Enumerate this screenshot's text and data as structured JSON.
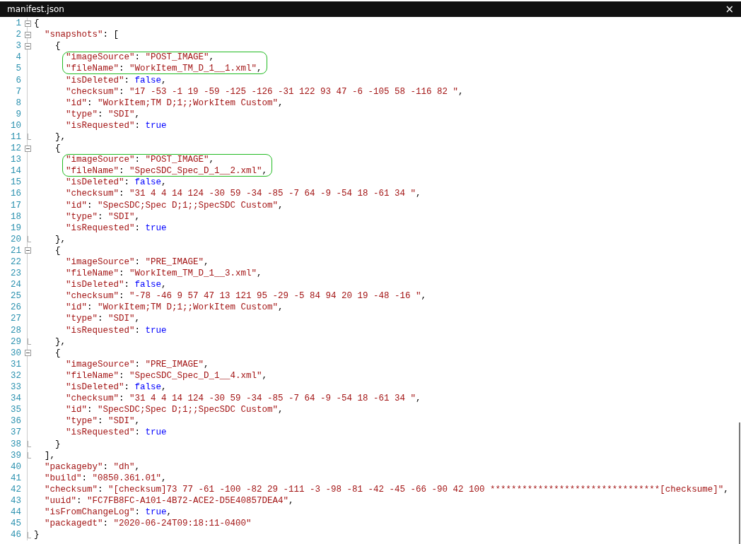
{
  "window": {
    "title": "manifest.json",
    "close": "×"
  },
  "lines": [
    {
      "number": "1",
      "expanded": true,
      "segments": [
        {
          "kind": "punct",
          "text": "{"
        }
      ],
      "children": [
        {
          "number": "2",
          "expanded": true,
          "segments": [
            {
              "kind": "string",
              "text": "\"snapshots\""
            },
            {
              "kind": "punct",
              "text": ": ["
            }
          ],
          "children": [
            {
              "number": "3",
              "expanded": true,
              "segments": [
                {
                  "kind": "punct",
                  "text": "{"
                }
              ],
              "children": [
                {
                  "number": "4",
                  "boxed": true,
                  "segments": [
                    {
                      "kind": "string",
                      "text": "\"imageSource\""
                    },
                    {
                      "kind": "punct",
                      "text": ": "
                    },
                    {
                      "kind": "string",
                      "text": "\"POST_IMAGE\""
                    },
                    {
                      "kind": "punct",
                      "text": ","
                    }
                  ]
                },
                {
                  "number": "5",
                  "boxed": true,
                  "segments": [
                    {
                      "kind": "string",
                      "text": "\"fileName\""
                    },
                    {
                      "kind": "punct",
                      "text": ": "
                    },
                    {
                      "kind": "string",
                      "text": "\"WorkItem_TM_D_1__1.xml\""
                    },
                    {
                      "kind": "punct",
                      "text": ","
                    }
                  ]
                },
                {
                  "number": "6",
                  "boxed": false,
                  "segments": [
                    {
                      "kind": "string",
                      "text": "\"isDeleted\""
                    },
                    {
                      "kind": "punct",
                      "text": ": "
                    },
                    {
                      "kind": "keyword",
                      "text": "false"
                    },
                    {
                      "kind": "punct",
                      "text": ","
                    }
                  ]
                },
                {
                  "number": "7",
                  "boxed": false,
                  "segments": [
                    {
                      "kind": "string",
                      "text": "\"checksum\""
                    },
                    {
                      "kind": "punct",
                      "text": ": "
                    },
                    {
                      "kind": "string",
                      "text": "\"17 -53 -1 19 -59 -125 -126 -31 122 93 47 -6 -105 58 -116 82 \""
                    },
                    {
                      "kind": "punct",
                      "text": ","
                    }
                  ]
                },
                {
                  "number": "8",
                  "boxed": false,
                  "segments": [
                    {
                      "kind": "string",
                      "text": "\"id\""
                    },
                    {
                      "kind": "punct",
                      "text": ": "
                    },
                    {
                      "kind": "string",
                      "text": "\"WorkItem;TM D;1;;WorkItem Custom\""
                    },
                    {
                      "kind": "punct",
                      "text": ","
                    }
                  ]
                },
                {
                  "number": "9",
                  "boxed": false,
                  "segments": [
                    {
                      "kind": "string",
                      "text": "\"type\""
                    },
                    {
                      "kind": "punct",
                      "text": ": "
                    },
                    {
                      "kind": "string",
                      "text": "\"SDI\""
                    },
                    {
                      "kind": "punct",
                      "text": ","
                    }
                  ]
                },
                {
                  "number": "10",
                  "boxed": false,
                  "segments": [
                    {
                      "kind": "string",
                      "text": "\"isRequested\""
                    },
                    {
                      "kind": "punct",
                      "text": ": "
                    },
                    {
                      "kind": "keyword",
                      "text": "true"
                    }
                  ]
                }
              ]
            },
            {
              "number": "11",
              "segments": [
                {
                  "kind": "punct",
                  "text": "},"
                }
              ]
            },
            {
              "number": "12",
              "expanded": true,
              "segments": [
                {
                  "kind": "punct",
                  "text": "{"
                }
              ],
              "children": [
                {
                  "number": "13",
                  "boxed": true,
                  "segments": [
                    {
                      "kind": "string",
                      "text": "\"imageSource\""
                    },
                    {
                      "kind": "punct",
                      "text": ": "
                    },
                    {
                      "kind": "string",
                      "text": "\"POST_IMAGE\""
                    },
                    {
                      "kind": "punct",
                      "text": ","
                    }
                  ]
                },
                {
                  "number": "14",
                  "boxed": true,
                  "segments": [
                    {
                      "kind": "string",
                      "text": "\"fileName\""
                    },
                    {
                      "kind": "punct",
                      "text": ": "
                    },
                    {
                      "kind": "string",
                      "text": "\"SpecSDC_Spec_D_1__2.xml\""
                    },
                    {
                      "kind": "punct",
                      "text": ","
                    }
                  ]
                },
                {
                  "number": "15",
                  "boxed": false,
                  "segments": [
                    {
                      "kind": "string",
                      "text": "\"isDeleted\""
                    },
                    {
                      "kind": "punct",
                      "text": ": "
                    },
                    {
                      "kind": "keyword",
                      "text": "false"
                    },
                    {
                      "kind": "punct",
                      "text": ","
                    }
                  ]
                },
                {
                  "number": "16",
                  "boxed": false,
                  "segments": [
                    {
                      "kind": "string",
                      "text": "\"checksum\""
                    },
                    {
                      "kind": "punct",
                      "text": ": "
                    },
                    {
                      "kind": "string",
                      "text": "\"31 4 4 14 124 -30 59 -34 -85 -7 64 -9 -54 18 -61 34 \""
                    },
                    {
                      "kind": "punct",
                      "text": ","
                    }
                  ]
                },
                {
                  "number": "17",
                  "boxed": false,
                  "segments": [
                    {
                      "kind": "string",
                      "text": "\"id\""
                    },
                    {
                      "kind": "punct",
                      "text": ": "
                    },
                    {
                      "kind": "string",
                      "text": "\"SpecSDC;Spec D;1;;SpecSDC Custom\""
                    },
                    {
                      "kind": "punct",
                      "text": ","
                    }
                  ]
                },
                {
                  "number": "18",
                  "boxed": false,
                  "segments": [
                    {
                      "kind": "string",
                      "text": "\"type\""
                    },
                    {
                      "kind": "punct",
                      "text": ": "
                    },
                    {
                      "kind": "string",
                      "text": "\"SDI\""
                    },
                    {
                      "kind": "punct",
                      "text": ","
                    }
                  ]
                },
                {
                  "number": "19",
                  "boxed": false,
                  "segments": [
                    {
                      "kind": "string",
                      "text": "\"isRequested\""
                    },
                    {
                      "kind": "punct",
                      "text": ": "
                    },
                    {
                      "kind": "keyword",
                      "text": "true"
                    }
                  ]
                }
              ]
            },
            {
              "number": "20",
              "segments": [
                {
                  "kind": "punct",
                  "text": "},"
                }
              ]
            },
            {
              "number": "21",
              "expanded": true,
              "segments": [
                {
                  "kind": "punct",
                  "text": "{"
                }
              ],
              "children": [
                {
                  "number": "22",
                  "boxed": false,
                  "segments": [
                    {
                      "kind": "string",
                      "text": "\"imageSource\""
                    },
                    {
                      "kind": "punct",
                      "text": ": "
                    },
                    {
                      "kind": "string",
                      "text": "\"PRE_IMAGE\""
                    },
                    {
                      "kind": "punct",
                      "text": ","
                    }
                  ]
                },
                {
                  "number": "23",
                  "boxed": false,
                  "segments": [
                    {
                      "kind": "string",
                      "text": "\"fileName\""
                    },
                    {
                      "kind": "punct",
                      "text": ": "
                    },
                    {
                      "kind": "string",
                      "text": "\"WorkItem_TM_D_1__3.xml\""
                    },
                    {
                      "kind": "punct",
                      "text": ","
                    }
                  ]
                },
                {
                  "number": "24",
                  "boxed": false,
                  "segments": [
                    {
                      "kind": "string",
                      "text": "\"isDeleted\""
                    },
                    {
                      "kind": "punct",
                      "text": ": "
                    },
                    {
                      "kind": "keyword",
                      "text": "false"
                    },
                    {
                      "kind": "punct",
                      "text": ","
                    }
                  ]
                },
                {
                  "number": "25",
                  "boxed": false,
                  "segments": [
                    {
                      "kind": "string",
                      "text": "\"checksum\""
                    },
                    {
                      "kind": "punct",
                      "text": ": "
                    },
                    {
                      "kind": "string",
                      "text": "\"-78 -46 9 57 47 13 121 95 -29 -5 84 94 20 19 -48 -16 \""
                    },
                    {
                      "kind": "punct",
                      "text": ","
                    }
                  ]
                },
                {
                  "number": "26",
                  "boxed": false,
                  "segments": [
                    {
                      "kind": "string",
                      "text": "\"id\""
                    },
                    {
                      "kind": "punct",
                      "text": ": "
                    },
                    {
                      "kind": "string",
                      "text": "\"WorkItem;TM D;1;;WorkItem Custom\""
                    },
                    {
                      "kind": "punct",
                      "text": ","
                    }
                  ]
                },
                {
                  "number": "27",
                  "boxed": false,
                  "segments": [
                    {
                      "kind": "string",
                      "text": "\"type\""
                    },
                    {
                      "kind": "punct",
                      "text": ": "
                    },
                    {
                      "kind": "string",
                      "text": "\"SDI\""
                    },
                    {
                      "kind": "punct",
                      "text": ","
                    }
                  ]
                },
                {
                  "number": "28",
                  "boxed": false,
                  "segments": [
                    {
                      "kind": "string",
                      "text": "\"isRequested\""
                    },
                    {
                      "kind": "punct",
                      "text": ": "
                    },
                    {
                      "kind": "keyword",
                      "text": "true"
                    }
                  ]
                }
              ]
            },
            {
              "number": "29",
              "segments": [
                {
                  "kind": "punct",
                  "text": "},"
                }
              ]
            },
            {
              "number": "30",
              "expanded": true,
              "segments": [
                {
                  "kind": "punct",
                  "text": "{"
                }
              ],
              "children": [
                {
                  "number": "31",
                  "boxed": false,
                  "segments": [
                    {
                      "kind": "string",
                      "text": "\"imageSource\""
                    },
                    {
                      "kind": "punct",
                      "text": ": "
                    },
                    {
                      "kind": "string",
                      "text": "\"PRE_IMAGE\""
                    },
                    {
                      "kind": "punct",
                      "text": ","
                    }
                  ]
                },
                {
                  "number": "32",
                  "boxed": false,
                  "segments": [
                    {
                      "kind": "string",
                      "text": "\"fileName\""
                    },
                    {
                      "kind": "punct",
                      "text": ": "
                    },
                    {
                      "kind": "string",
                      "text": "\"SpecSDC_Spec_D_1__4.xml\""
                    },
                    {
                      "kind": "punct",
                      "text": ","
                    }
                  ]
                },
                {
                  "number": "33",
                  "boxed": false,
                  "segments": [
                    {
                      "kind": "string",
                      "text": "\"isDeleted\""
                    },
                    {
                      "kind": "punct",
                      "text": ": "
                    },
                    {
                      "kind": "keyword",
                      "text": "false"
                    },
                    {
                      "kind": "punct",
                      "text": ","
                    }
                  ]
                },
                {
                  "number": "34",
                  "boxed": false,
                  "segments": [
                    {
                      "kind": "string",
                      "text": "\"checksum\""
                    },
                    {
                      "kind": "punct",
                      "text": ": "
                    },
                    {
                      "kind": "string",
                      "text": "\"31 4 4 14 124 -30 59 -34 -85 -7 64 -9 -54 18 -61 34 \""
                    },
                    {
                      "kind": "punct",
                      "text": ","
                    }
                  ]
                },
                {
                  "number": "35",
                  "boxed": false,
                  "segments": [
                    {
                      "kind": "string",
                      "text": "\"id\""
                    },
                    {
                      "kind": "punct",
                      "text": ": "
                    },
                    {
                      "kind": "string",
                      "text": "\"SpecSDC;Spec D;1;;SpecSDC Custom\""
                    },
                    {
                      "kind": "punct",
                      "text": ","
                    }
                  ]
                },
                {
                  "number": "36",
                  "boxed": false,
                  "segments": [
                    {
                      "kind": "string",
                      "text": "\"type\""
                    },
                    {
                      "kind": "punct",
                      "text": ": "
                    },
                    {
                      "kind": "string",
                      "text": "\"SDI\""
                    },
                    {
                      "kind": "punct",
                      "text": ","
                    }
                  ]
                },
                {
                  "number": "37",
                  "boxed": false,
                  "segments": [
                    {
                      "kind": "string",
                      "text": "\"isRequested\""
                    },
                    {
                      "kind": "punct",
                      "text": ": "
                    },
                    {
                      "kind": "keyword",
                      "text": "true"
                    }
                  ]
                }
              ]
            },
            {
              "number": "38",
              "segments": [
                {
                  "kind": "punct",
                  "text": "}"
                }
              ]
            }
          ]
        },
        {
          "number": "39",
          "segments": [
            {
              "kind": "punct",
              "text": "],"
            }
          ]
        },
        {
          "number": "40",
          "segments": [
            {
              "kind": "string",
              "text": "\"packageby\""
            },
            {
              "kind": "punct",
              "text": ": "
            },
            {
              "kind": "string",
              "text": "\"dh\""
            },
            {
              "kind": "punct",
              "text": ","
            }
          ]
        },
        {
          "number": "41",
          "segments": [
            {
              "kind": "string",
              "text": "\"build\""
            },
            {
              "kind": "punct",
              "text": ": "
            },
            {
              "kind": "string",
              "text": "\"0850.361.01\""
            },
            {
              "kind": "punct",
              "text": ","
            }
          ]
        },
        {
          "number": "42",
          "segments": [
            {
              "kind": "string",
              "text": "\"checksum\""
            },
            {
              "kind": "punct",
              "text": ": "
            },
            {
              "kind": "string",
              "text": "\"[checksum]73 77 -61 -100 -82 29 -111 -3 -98 -81 -42 -45 -66 -90 42 100 ********************************[checksume]\""
            },
            {
              "kind": "punct",
              "text": ","
            }
          ]
        },
        {
          "number": "43",
          "segments": [
            {
              "kind": "string",
              "text": "\"uuid\""
            },
            {
              "kind": "punct",
              "text": ": "
            },
            {
              "kind": "string",
              "text": "\"FC7FB8FC-A101-4B72-ACE2-D5E40857DEA4\""
            },
            {
              "kind": "punct",
              "text": ","
            }
          ]
        },
        {
          "number": "44",
          "segments": [
            {
              "kind": "string",
              "text": "\"isFromChangeLog\""
            },
            {
              "kind": "punct",
              "text": ": "
            },
            {
              "kind": "keyword",
              "text": "true"
            },
            {
              "kind": "punct",
              "text": ","
            }
          ]
        },
        {
          "number": "45",
          "segments": [
            {
              "kind": "string",
              "text": "\"packagedt\""
            },
            {
              "kind": "punct",
              "text": ": "
            },
            {
              "kind": "string",
              "text": "\"2020-06-24T09:18:11-0400\""
            }
          ]
        }
      ]
    },
    {
      "number": "46",
      "segments": [
        {
          "kind": "punct",
          "text": "}"
        }
      ]
    }
  ]
}
